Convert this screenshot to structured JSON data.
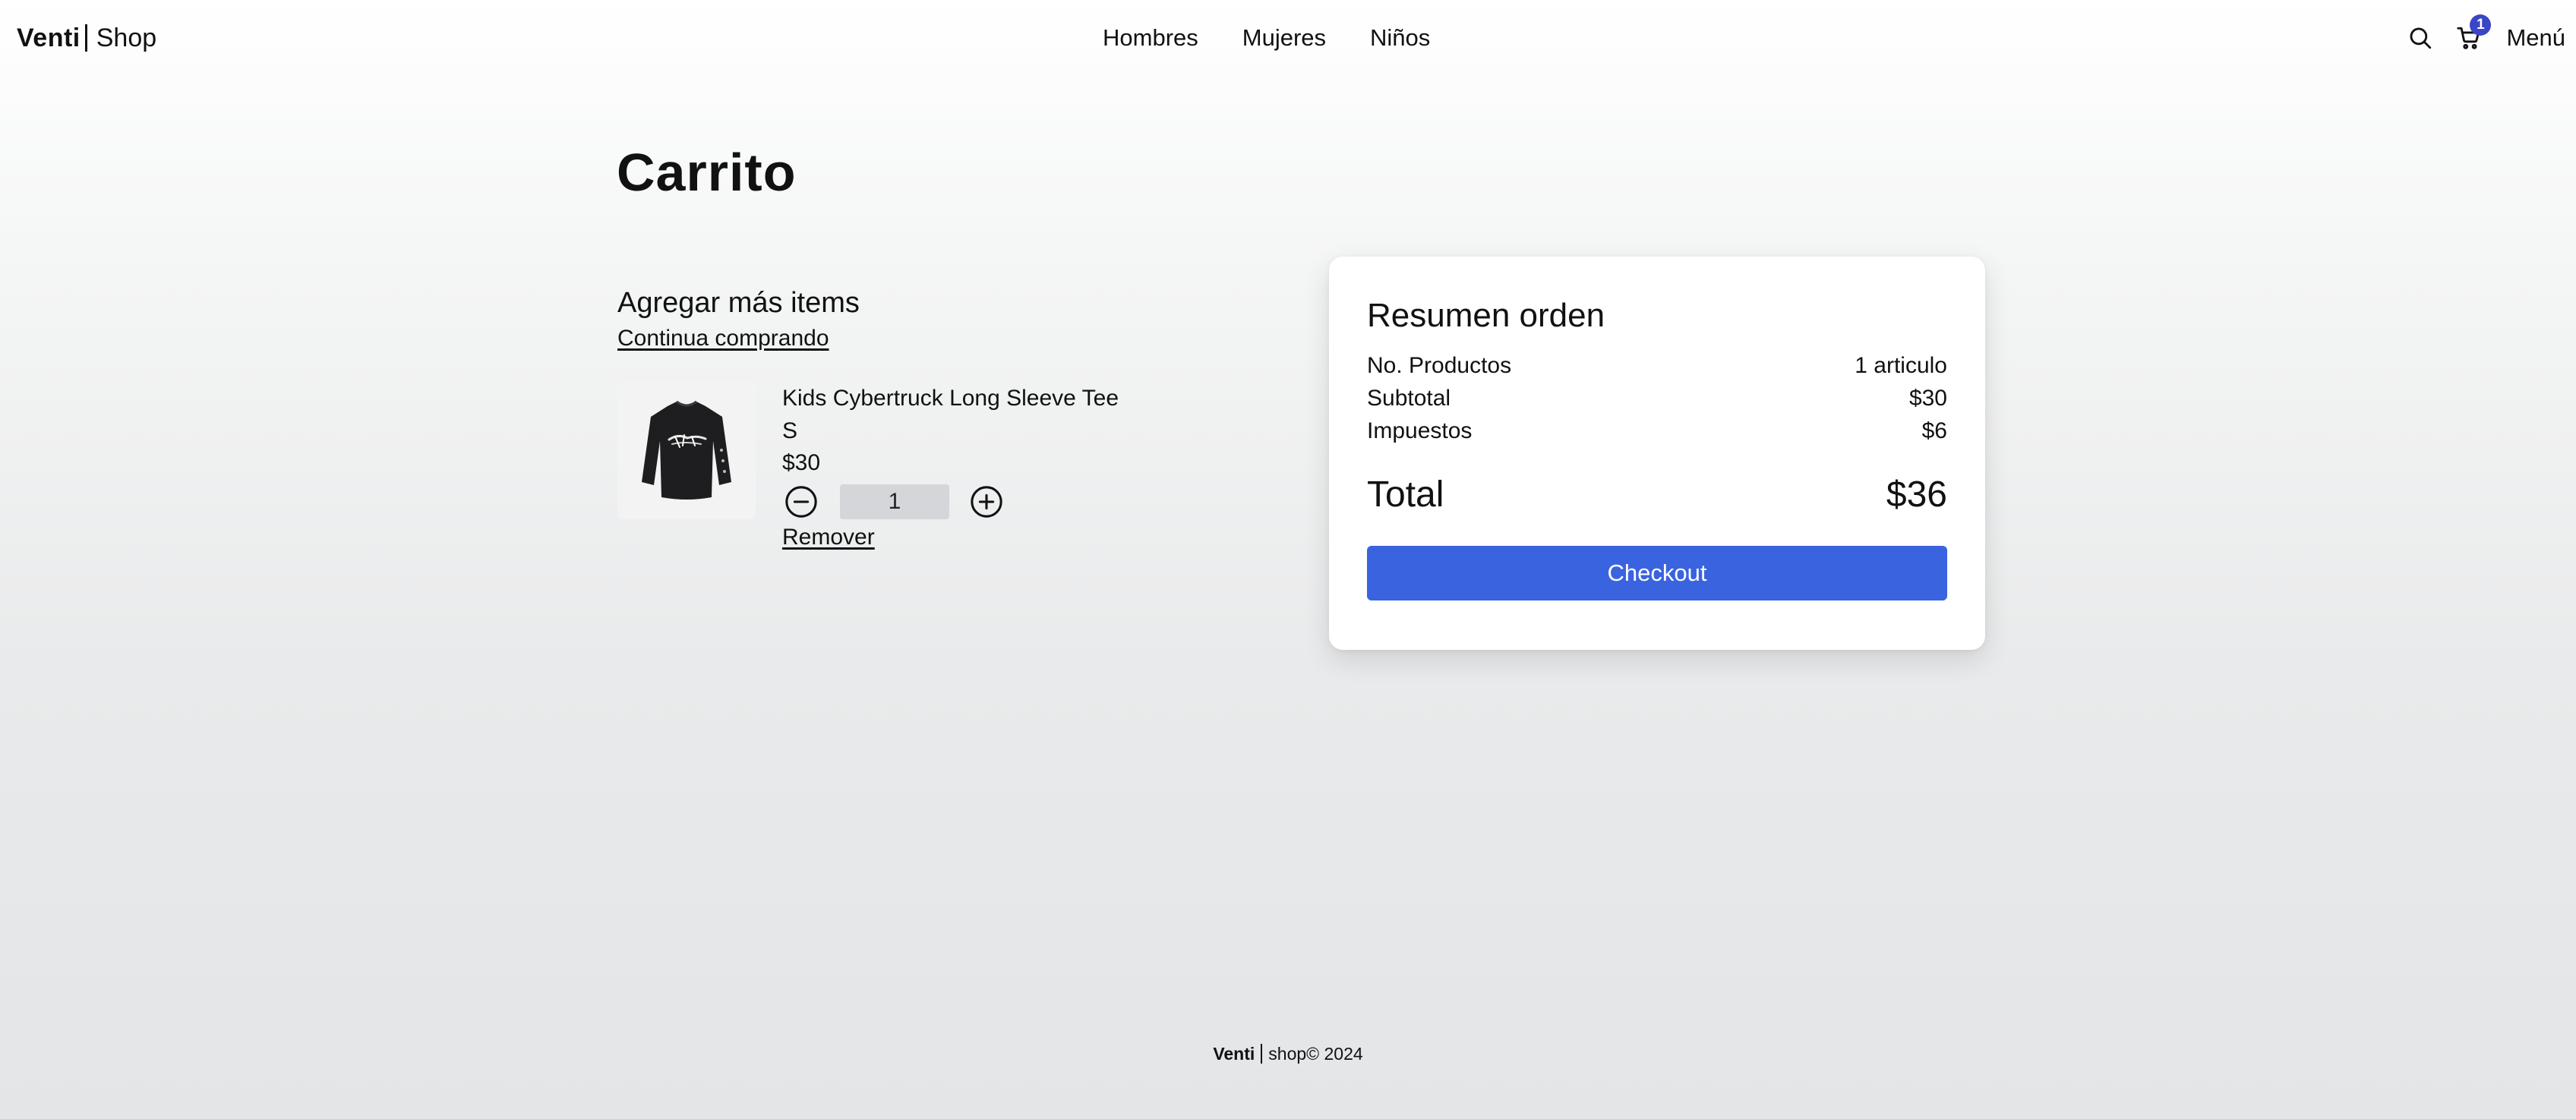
{
  "header": {
    "brand_name": "Venti",
    "brand_shop": "Shop",
    "nav": [
      "Hombres",
      "Mujeres",
      "Niños"
    ],
    "cart_count": "1",
    "menu_label": "Menú",
    "icons": {
      "search": "search-icon",
      "cart": "cart-icon"
    }
  },
  "page": {
    "title": "Carrito"
  },
  "cart": {
    "add_more_title": "Agregar más items",
    "continue_link": "Continua comprando",
    "items": [
      {
        "name": "Kids Cybertruck Long Sleeve Tee",
        "size": "S",
        "price": "$30",
        "quantity": "1",
        "remove_label": "Remover",
        "image": "black long sleeve tee"
      }
    ]
  },
  "summary": {
    "title": "Resumen orden",
    "products_label": "No. Productos",
    "products_value": "1 articulo",
    "subtotal_label": "Subtotal",
    "subtotal_value": "$30",
    "taxes_label": "Impuestos",
    "taxes_value": "$6",
    "total_label": "Total",
    "total_value": "$36",
    "checkout_label": "Checkout"
  },
  "footer": {
    "brand": "Venti",
    "text": "shop© 2024"
  },
  "colors": {
    "accent": "#3a63e0",
    "badge": "#3a46c7",
    "quantity_bg": "#d4d6da"
  }
}
